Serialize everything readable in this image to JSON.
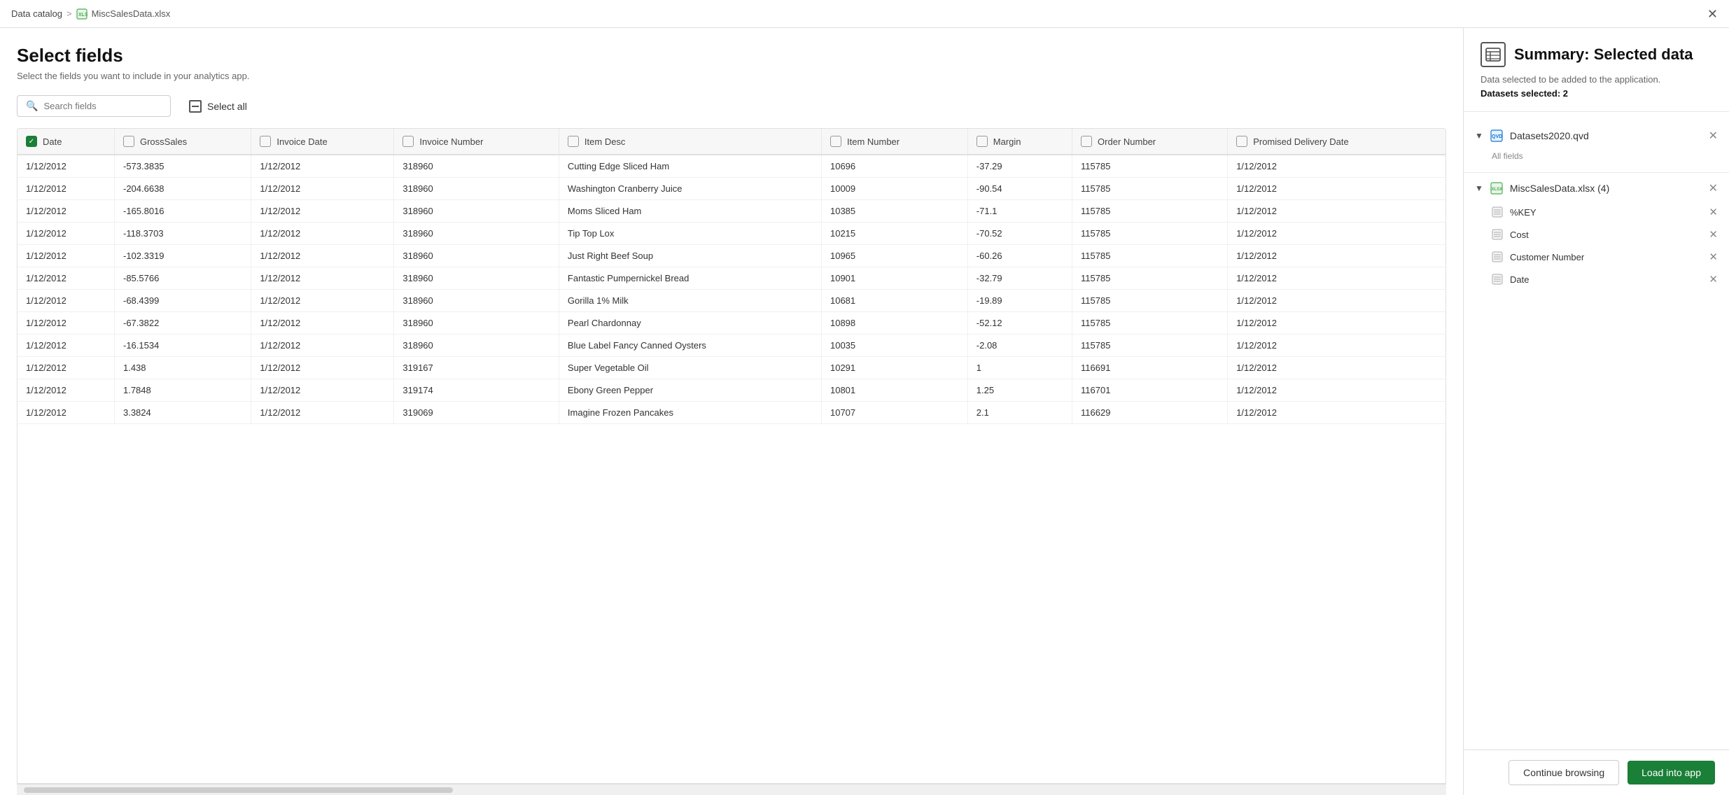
{
  "topbar": {
    "breadcrumb_home": "Data catalog",
    "breadcrumb_sep": ">",
    "breadcrumb_file": "MiscSalesData.xlsx"
  },
  "page": {
    "title": "Select fields",
    "subtitle": "Select the fields you want to include in your analytics app."
  },
  "toolbar": {
    "search_placeholder": "Search fields",
    "select_all_label": "Select all"
  },
  "table": {
    "columns": [
      {
        "id": "date",
        "label": "Date",
        "checked": true
      },
      {
        "id": "grosssales",
        "label": "GrossSales",
        "checked": false
      },
      {
        "id": "invoicedate",
        "label": "Invoice Date",
        "checked": false
      },
      {
        "id": "invoicenumber",
        "label": "Invoice Number",
        "checked": false
      },
      {
        "id": "itemdesc",
        "label": "Item Desc",
        "checked": false
      },
      {
        "id": "itemnumber",
        "label": "Item Number",
        "checked": false
      },
      {
        "id": "margin",
        "label": "Margin",
        "checked": false
      },
      {
        "id": "ordernumber",
        "label": "Order Number",
        "checked": false
      },
      {
        "id": "promiseddeliverydate",
        "label": "Promised Delivery Date",
        "checked": false
      }
    ],
    "rows": [
      {
        "date": "1/12/2012",
        "grosssales": "-573.3835",
        "invoicedate": "1/12/2012",
        "invoicenumber": "318960",
        "itemdesc": "Cutting Edge Sliced Ham",
        "itemnumber": "10696",
        "margin": "-37.29",
        "ordernumber": "115785",
        "promiseddeliverydate": "1/12/2012"
      },
      {
        "date": "1/12/2012",
        "grosssales": "-204.6638",
        "invoicedate": "1/12/2012",
        "invoicenumber": "318960",
        "itemdesc": "Washington Cranberry Juice",
        "itemnumber": "10009",
        "margin": "-90.54",
        "ordernumber": "115785",
        "promiseddeliverydate": "1/12/2012"
      },
      {
        "date": "1/12/2012",
        "grosssales": "-165.8016",
        "invoicedate": "1/12/2012",
        "invoicenumber": "318960",
        "itemdesc": "Moms Sliced Ham",
        "itemnumber": "10385",
        "margin": "-71.1",
        "ordernumber": "115785",
        "promiseddeliverydate": "1/12/2012"
      },
      {
        "date": "1/12/2012",
        "grosssales": "-118.3703",
        "invoicedate": "1/12/2012",
        "invoicenumber": "318960",
        "itemdesc": "Tip Top Lox",
        "itemnumber": "10215",
        "margin": "-70.52",
        "ordernumber": "115785",
        "promiseddeliverydate": "1/12/2012"
      },
      {
        "date": "1/12/2012",
        "grosssales": "-102.3319",
        "invoicedate": "1/12/2012",
        "invoicenumber": "318960",
        "itemdesc": "Just Right Beef Soup",
        "itemnumber": "10965",
        "margin": "-60.26",
        "ordernumber": "115785",
        "promiseddeliverydate": "1/12/2012"
      },
      {
        "date": "1/12/2012",
        "grosssales": "-85.5766",
        "invoicedate": "1/12/2012",
        "invoicenumber": "318960",
        "itemdesc": "Fantastic Pumpernickel Bread",
        "itemnumber": "10901",
        "margin": "-32.79",
        "ordernumber": "115785",
        "promiseddeliverydate": "1/12/2012"
      },
      {
        "date": "1/12/2012",
        "grosssales": "-68.4399",
        "invoicedate": "1/12/2012",
        "invoicenumber": "318960",
        "itemdesc": "Gorilla 1% Milk",
        "itemnumber": "10681",
        "margin": "-19.89",
        "ordernumber": "115785",
        "promiseddeliverydate": "1/12/2012"
      },
      {
        "date": "1/12/2012",
        "grosssales": "-67.3822",
        "invoicedate": "1/12/2012",
        "invoicenumber": "318960",
        "itemdesc": "Pearl Chardonnay",
        "itemnumber": "10898",
        "margin": "-52.12",
        "ordernumber": "115785",
        "promiseddeliverydate": "1/12/2012"
      },
      {
        "date": "1/12/2012",
        "grosssales": "-16.1534",
        "invoicedate": "1/12/2012",
        "invoicenumber": "318960",
        "itemdesc": "Blue Label Fancy Canned Oysters",
        "itemnumber": "10035",
        "margin": "-2.08",
        "ordernumber": "115785",
        "promiseddeliverydate": "1/12/2012"
      },
      {
        "date": "1/12/2012",
        "grosssales": "1.438",
        "invoicedate": "1/12/2012",
        "invoicenumber": "319167",
        "itemdesc": "Super Vegetable Oil",
        "itemnumber": "10291",
        "margin": "1",
        "ordernumber": "116691",
        "promiseddeliverydate": "1/12/2012"
      },
      {
        "date": "1/12/2012",
        "grosssales": "1.7848",
        "invoicedate": "1/12/2012",
        "invoicenumber": "319174",
        "itemdesc": "Ebony Green Pepper",
        "itemnumber": "10801",
        "margin": "1.25",
        "ordernumber": "116701",
        "promiseddeliverydate": "1/12/2012"
      },
      {
        "date": "1/12/2012",
        "grosssales": "3.3824",
        "invoicedate": "1/12/2012",
        "invoicenumber": "319069",
        "itemdesc": "Imagine Frozen Pancakes",
        "itemnumber": "10707",
        "margin": "2.1",
        "ordernumber": "116629",
        "promiseddeliverydate": "1/12/2012"
      }
    ]
  },
  "summary": {
    "icon": "🗂",
    "title": "Summary: Selected data",
    "desc": "Data selected to be added to the application.",
    "datasets_label": "Datasets selected: 2",
    "dataset1": {
      "name": "Datasets2020.qvd",
      "all_fields_label": "All fields"
    },
    "dataset2": {
      "name": "MiscSalesData.xlsx (4)",
      "fields": [
        {
          "name": "%KEY",
          "type": "table"
        },
        {
          "name": "Cost",
          "type": "table"
        },
        {
          "name": "Customer Number",
          "type": "table"
        },
        {
          "name": "Date",
          "type": "table"
        }
      ]
    }
  },
  "buttons": {
    "continue_browsing": "Continue browsing",
    "load_into_app": "Load into app"
  }
}
